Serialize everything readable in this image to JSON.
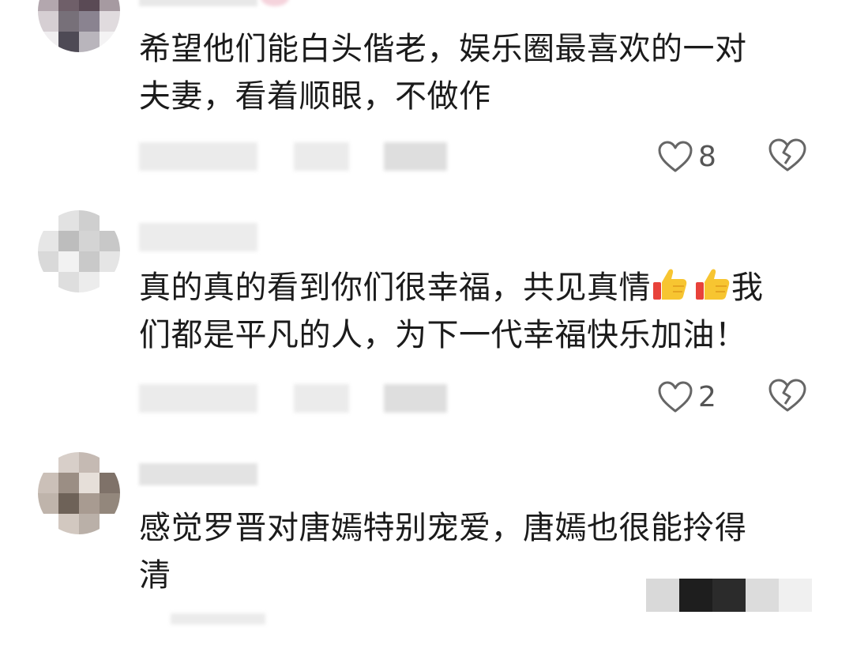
{
  "comments": [
    {
      "username": "",
      "text_lines": [
        "希望他们能白头偕老，娱乐圈最喜欢的一对",
        "夫妻，看着顺眼，不做作"
      ],
      "likes": "8"
    },
    {
      "username": "",
      "text_lines": [
        "真的真的看到你们很幸福，共见真情",
        "我",
        "们都是平凡的人，为下一代幸福快乐加油！"
      ],
      "likes": "2"
    },
    {
      "username": "",
      "text_lines": [
        "感觉罗晋对唐嫣特别宠爱，唐嫣也很能拎得",
        "清"
      ]
    }
  ],
  "icons": {
    "like": "heart-outline-icon",
    "dislike": "broken-heart-icon",
    "emoji": "thumbs-up-emoji-icon"
  },
  "colors": {
    "text": "#1b1b1b",
    "icon": "#666666",
    "muted": "#b8b8b8"
  }
}
